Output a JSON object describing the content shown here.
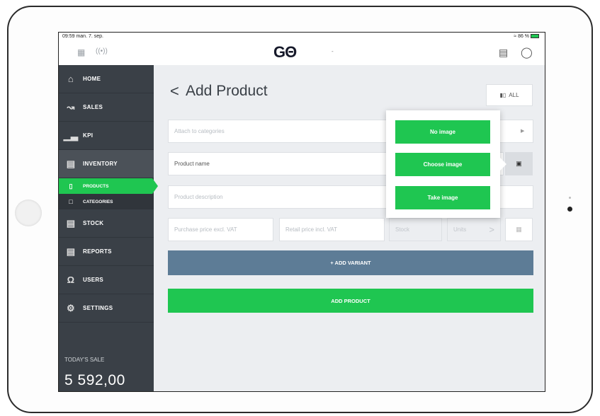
{
  "status_bar": {
    "time": "09:59  man. 7. sep.",
    "battery": "86 %"
  },
  "topbar": {
    "logo": "GΘ",
    "dot": "-"
  },
  "sidebar": {
    "items": [
      {
        "label": "HOME",
        "icon": "home-icon"
      },
      {
        "label": "SALES",
        "icon": "sales-chart-icon"
      },
      {
        "label": "KPI",
        "icon": "kpi-bars-icon"
      },
      {
        "label": "INVENTORY",
        "icon": "inventory-box-icon"
      },
      {
        "label": "STOCK",
        "icon": "stock-box-icon"
      },
      {
        "label": "REPORTS",
        "icon": "reports-doc-icon"
      },
      {
        "label": "USERS",
        "icon": "users-icon"
      },
      {
        "label": "SETTINGS",
        "icon": "gear-icon"
      }
    ],
    "sub_items": [
      {
        "label": "PRODUCTS",
        "icon": "products-icon"
      },
      {
        "label": "CATEGORIES",
        "icon": "folder-icon"
      }
    ],
    "today_label": "TODAY'S SALE",
    "today_value": "5 592,00"
  },
  "main": {
    "back": "<",
    "title": "Add Product",
    "all_button": "ALL",
    "categories_placeholder": "Attach to categories",
    "product_name": "Product name",
    "product_description": "Product description",
    "purchase_price": "Purchase price excl. VAT",
    "retail_price": "Retail price incl. VAT",
    "stock": "Stock",
    "units": "Units",
    "units_arrow": ">",
    "add_variant": "+ ADD VARIANT",
    "add_product": "ADD PRODUCT"
  },
  "popover": {
    "no_image": "No image",
    "choose_image": "Choose image",
    "take_image": "Take image"
  },
  "colors": {
    "accent_green": "#1fc651",
    "sidebar": "#3a4047",
    "variant": "#5d7c96"
  }
}
